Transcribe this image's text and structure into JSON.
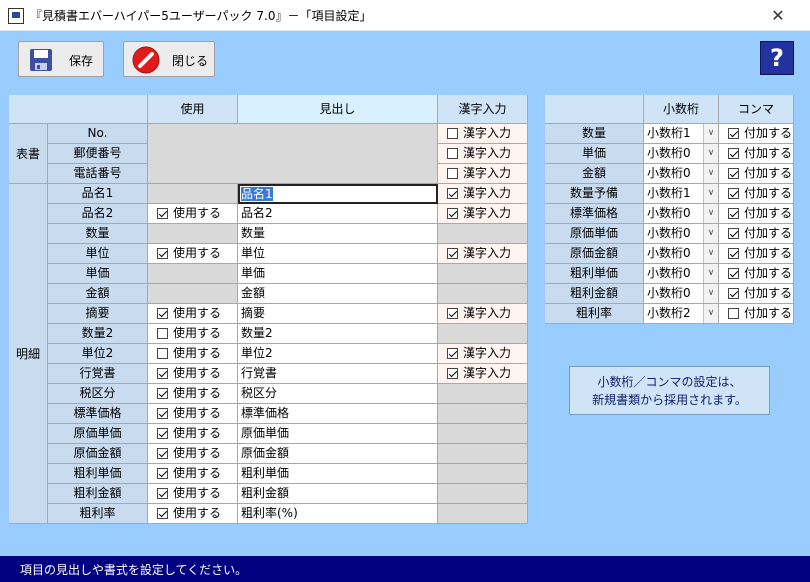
{
  "window": {
    "title": "『見積書エバーハイパー5ユーザーパック 7.0』－「項目設定」",
    "close_glyph": "✕"
  },
  "toolbar": {
    "save_label": "保存",
    "close_label": "閉じる",
    "help_glyph": "?"
  },
  "main_table": {
    "headers": {
      "use": "使用",
      "heading": "見出し",
      "kanji": "漢字入力"
    },
    "group_header": "表書",
    "group_detail": "明細",
    "header_rows": [
      {
        "label": "No.",
        "kanji_label": "漢字入力",
        "kanji_checked": false
      },
      {
        "label": "郵便番号",
        "kanji_label": "漢字入力",
        "kanji_checked": false
      },
      {
        "label": "電話番号",
        "kanji_label": "漢字入力",
        "kanji_checked": false
      }
    ],
    "detail_rows": [
      {
        "label": "品名1",
        "has_use": false,
        "use_label": "",
        "use_checked": false,
        "heading": "品名1",
        "editing": true,
        "has_kanji": true,
        "kanji_label": "漢字入力",
        "kanji_checked": true
      },
      {
        "label": "品名2",
        "has_use": true,
        "use_label": "使用する",
        "use_checked": true,
        "heading": "品名2",
        "has_kanji": true,
        "kanji_label": "漢字入力",
        "kanji_checked": true
      },
      {
        "label": "数量",
        "has_use": false,
        "use_label": "",
        "use_checked": false,
        "heading": "数量",
        "has_kanji": false,
        "kanji_label": "",
        "kanji_checked": false
      },
      {
        "label": "単位",
        "has_use": true,
        "use_label": "使用する",
        "use_checked": true,
        "heading": "単位",
        "has_kanji": true,
        "kanji_label": "漢字入力",
        "kanji_checked": true
      },
      {
        "label": "単価",
        "has_use": false,
        "use_label": "",
        "use_checked": false,
        "heading": "単価",
        "has_kanji": false,
        "kanji_label": "",
        "kanji_checked": false
      },
      {
        "label": "金額",
        "has_use": false,
        "use_label": "",
        "use_checked": false,
        "heading": "金額",
        "has_kanji": false,
        "kanji_label": "",
        "kanji_checked": false
      },
      {
        "label": "摘要",
        "has_use": true,
        "use_label": "使用する",
        "use_checked": true,
        "heading": "摘要",
        "has_kanji": true,
        "kanji_label": "漢字入力",
        "kanji_checked": true
      },
      {
        "label": "数量2",
        "has_use": true,
        "use_label": "使用する",
        "use_checked": false,
        "heading": "数量2",
        "has_kanji": false,
        "kanji_label": "",
        "kanji_checked": false
      },
      {
        "label": "単位2",
        "has_use": true,
        "use_label": "使用する",
        "use_checked": false,
        "heading": "単位2",
        "has_kanji": true,
        "kanji_label": "漢字入力",
        "kanji_checked": true
      },
      {
        "label": "行覚書",
        "has_use": true,
        "use_label": "使用する",
        "use_checked": true,
        "heading": "行覚書",
        "has_kanji": true,
        "kanji_label": "漢字入力",
        "kanji_checked": true
      },
      {
        "label": "税区分",
        "has_use": true,
        "use_label": "使用する",
        "use_checked": true,
        "heading": "税区分",
        "has_kanji": false,
        "kanji_label": "",
        "kanji_checked": false
      },
      {
        "label": "標準価格",
        "has_use": true,
        "use_label": "使用する",
        "use_checked": true,
        "heading": "標準価格",
        "has_kanji": false,
        "kanji_label": "",
        "kanji_checked": false
      },
      {
        "label": "原価単価",
        "has_use": true,
        "use_label": "使用する",
        "use_checked": true,
        "heading": "原価単価",
        "has_kanji": false,
        "kanji_label": "",
        "kanji_checked": false
      },
      {
        "label": "原価金額",
        "has_use": true,
        "use_label": "使用する",
        "use_checked": true,
        "heading": "原価金額",
        "has_kanji": false,
        "kanji_label": "",
        "kanji_checked": false
      },
      {
        "label": "粗利単価",
        "has_use": true,
        "use_label": "使用する",
        "use_checked": true,
        "heading": "粗利単価",
        "has_kanji": false,
        "kanji_label": "",
        "kanji_checked": false
      },
      {
        "label": "粗利金額",
        "has_use": true,
        "use_label": "使用する",
        "use_checked": true,
        "heading": "粗利金額",
        "has_kanji": false,
        "kanji_label": "",
        "kanji_checked": false
      },
      {
        "label": "粗利率",
        "has_use": true,
        "use_label": "使用する",
        "use_checked": true,
        "heading": "粗利率(%)",
        "has_kanji": false,
        "kanji_label": "",
        "kanji_checked": false
      }
    ]
  },
  "decimal_table": {
    "headers": {
      "decimal": "小数桁",
      "comma": "コンマ"
    },
    "rows": [
      {
        "label": "数量",
        "decimal": "小数桁1",
        "comma_label": "付加する",
        "comma_checked": true
      },
      {
        "label": "単価",
        "decimal": "小数桁0",
        "comma_label": "付加する",
        "comma_checked": true
      },
      {
        "label": "金額",
        "decimal": "小数桁0",
        "comma_label": "付加する",
        "comma_checked": true
      },
      {
        "label": "数量予備",
        "decimal": "小数桁1",
        "comma_label": "付加する",
        "comma_checked": true
      },
      {
        "label": "標準価格",
        "decimal": "小数桁0",
        "comma_label": "付加する",
        "comma_checked": true
      },
      {
        "label": "原価単価",
        "decimal": "小数桁0",
        "comma_label": "付加する",
        "comma_checked": true
      },
      {
        "label": "原価金額",
        "decimal": "小数桁0",
        "comma_label": "付加する",
        "comma_checked": true
      },
      {
        "label": "粗利単価",
        "decimal": "小数桁0",
        "comma_label": "付加する",
        "comma_checked": true
      },
      {
        "label": "粗利金額",
        "decimal": "小数桁0",
        "comma_label": "付加する",
        "comma_checked": true
      },
      {
        "label": "粗利率",
        "decimal": "小数桁2",
        "comma_label": "付加する",
        "comma_checked": false
      }
    ]
  },
  "note": {
    "line1": "小数桁／コンマの設定は、",
    "line2": "新規書類から採用されます。"
  },
  "status": {
    "text": "項目の見出しや書式を設定してください。"
  },
  "colors": {
    "client_bg": "#99ccff",
    "status_bg": "#000080",
    "header_bg": "#cfe4f6",
    "save_icon": "#3c4fa0",
    "close_icon": "#e01b1b"
  }
}
